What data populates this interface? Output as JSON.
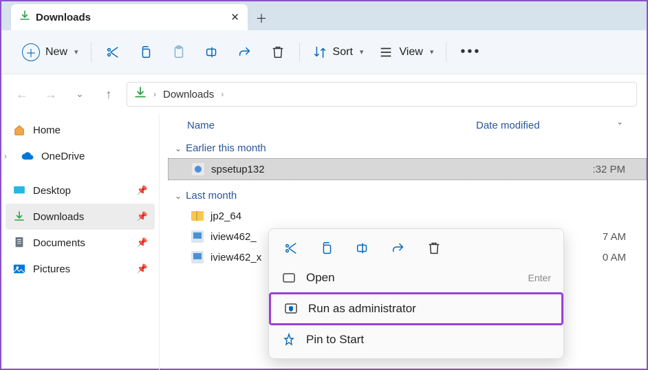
{
  "tab": {
    "title": "Downloads"
  },
  "toolbar": {
    "new": "New",
    "sort": "Sort",
    "view": "View"
  },
  "breadcrumb": {
    "item": "Downloads"
  },
  "sidebar": {
    "home": "Home",
    "onedrive": "OneDrive",
    "desktop": "Desktop",
    "downloads": "Downloads",
    "documents": "Documents",
    "pictures": "Pictures"
  },
  "columns": {
    "name": "Name",
    "date": "Date modified"
  },
  "groups": [
    {
      "label": "Earlier this month",
      "files": [
        {
          "name": "spsetup132",
          "date": ":32 PM",
          "dateprefix": ""
        }
      ]
    },
    {
      "label": "Last month",
      "files": [
        {
          "name": "jp2_64",
          "date": ""
        },
        {
          "name": "iview462_",
          "date": "7 AM"
        },
        {
          "name": "iview462_x",
          "date": "0 AM"
        }
      ]
    }
  ],
  "context": {
    "open": "Open",
    "open_hint": "Enter",
    "runas": "Run as administrator",
    "pin": "Pin to Start"
  }
}
